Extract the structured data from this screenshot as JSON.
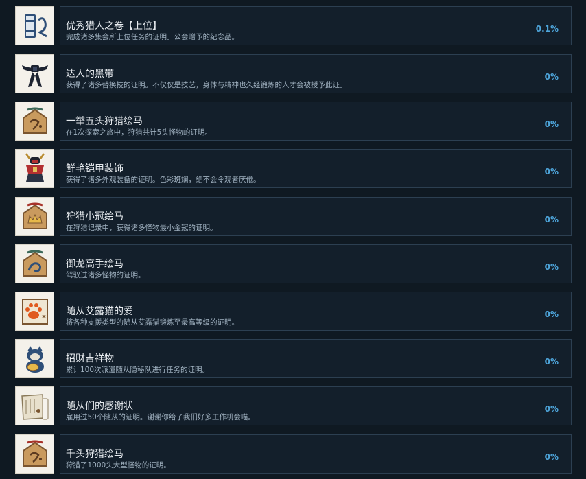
{
  "achievements": [
    {
      "title": "优秀猎人之卷【上位】",
      "desc": "完成诸多集会所上位任务的证明。公会赠予的纪念品。",
      "percent": "0.1%",
      "icon": "hunter-scroll-icon"
    },
    {
      "title": "达人的黑带",
      "desc": "获得了诸多替换技的证明。不仅仅是技艺，身体与精神也久经锻炼的人才会被授予此证。",
      "percent": "0%",
      "icon": "black-belt-icon"
    },
    {
      "title": "一举五头狩猎绘马",
      "desc": "在1次探索之旅中，狩猎共计5头怪物的证明。",
      "percent": "0%",
      "icon": "ema-plaque-icon"
    },
    {
      "title": "鲜艳铠甲装饰",
      "desc": "获得了诸多外观装备的证明。色彩斑斓，绝不会令观者厌倦。",
      "percent": "0%",
      "icon": "samurai-armor-icon"
    },
    {
      "title": "狩猎小冠绘马",
      "desc": "在狩猎记录中，获得诸多怪物最小金冠的证明。",
      "percent": "0%",
      "icon": "crown-ema-icon"
    },
    {
      "title": "御龙高手绘马",
      "desc": "驾驭过诸多怪物的证明。",
      "percent": "0%",
      "icon": "dragon-ema-icon"
    },
    {
      "title": "随从艾露猫的爱",
      "desc": "将各种支援类型的随从艾露猫锻炼至最高等级的证明。",
      "percent": "0%",
      "icon": "paw-print-icon"
    },
    {
      "title": "招财吉祥物",
      "desc": "累计100次派遣随从隐秘队进行任务的证明。",
      "percent": "0%",
      "icon": "lucky-cat-icon"
    },
    {
      "title": "随从们的感谢状",
      "desc": "雇用过50个随从的证明。谢谢你给了我们好多工作机会喵。",
      "percent": "0%",
      "icon": "thank-you-letter-icon"
    },
    {
      "title": "千头狩猎绘马",
      "desc": "狩猎了1000头大型怪物的证明。",
      "percent": "0%",
      "icon": "thousand-ema-icon"
    }
  ]
}
